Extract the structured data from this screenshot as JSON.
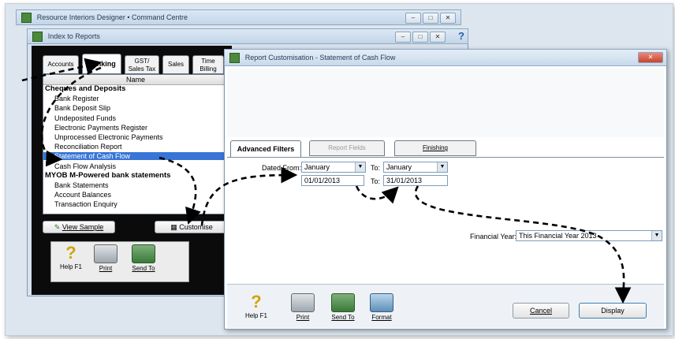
{
  "outer_window": {
    "title": "Resource Interiors Designer • Command Centre"
  },
  "index_window": {
    "title": "Index to Reports",
    "tabs": [
      "Accounts",
      "Banking",
      "GST/\nSales Tax",
      "Sales",
      "Time\nBilling"
    ],
    "list_header": "Name",
    "list_items": [
      {
        "label": "Cheques and Deposits",
        "bold": true
      },
      {
        "label": "Bank Register",
        "bold": false
      },
      {
        "label": "Bank Deposit Slip",
        "bold": false
      },
      {
        "label": "Undeposited Funds",
        "bold": false
      },
      {
        "label": "Electronic Payments Register",
        "bold": false
      },
      {
        "label": "Unprocessed Electronic Payments",
        "bold": false
      },
      {
        "label": "Reconciliation Report",
        "bold": false
      },
      {
        "label": "Statement of Cash Flow",
        "bold": false,
        "selected": true
      },
      {
        "label": "Cash Flow Analysis",
        "bold": false
      },
      {
        "label": "MYOB M-Powered bank statements",
        "bold": true
      },
      {
        "label": "Bank Statements",
        "bold": false
      },
      {
        "label": "Account Balances",
        "bold": false
      },
      {
        "label": "Transaction Enquiry",
        "bold": false
      }
    ],
    "view_sample": "View Sample",
    "customise": "Customise",
    "toolbar": {
      "help": "Help F1",
      "print": "Print",
      "send_to": "Send To"
    }
  },
  "dialog": {
    "title": "Report Customisation - Statement of Cash Flow",
    "tabs": [
      "Advanced Filters",
      "Report Fields",
      "Finishing"
    ],
    "dated_from_label": "Dated From:",
    "from_month": "January",
    "to_label": "To:",
    "to_month": "January",
    "from_date": "01/01/2013",
    "to_date": "31/01/2013",
    "financial_year_label": "Financial Year:",
    "financial_year_value": "This Financial Year 2013",
    "toolbar": {
      "help": "Help F1",
      "print": "Print",
      "send_to": "Send To",
      "format": "Format"
    },
    "cancel": "Cancel",
    "display": "Display"
  },
  "colors": {
    "selection": "#3875d7",
    "accent_arrow": "#000000",
    "dialog_title": "#2a3b55"
  }
}
